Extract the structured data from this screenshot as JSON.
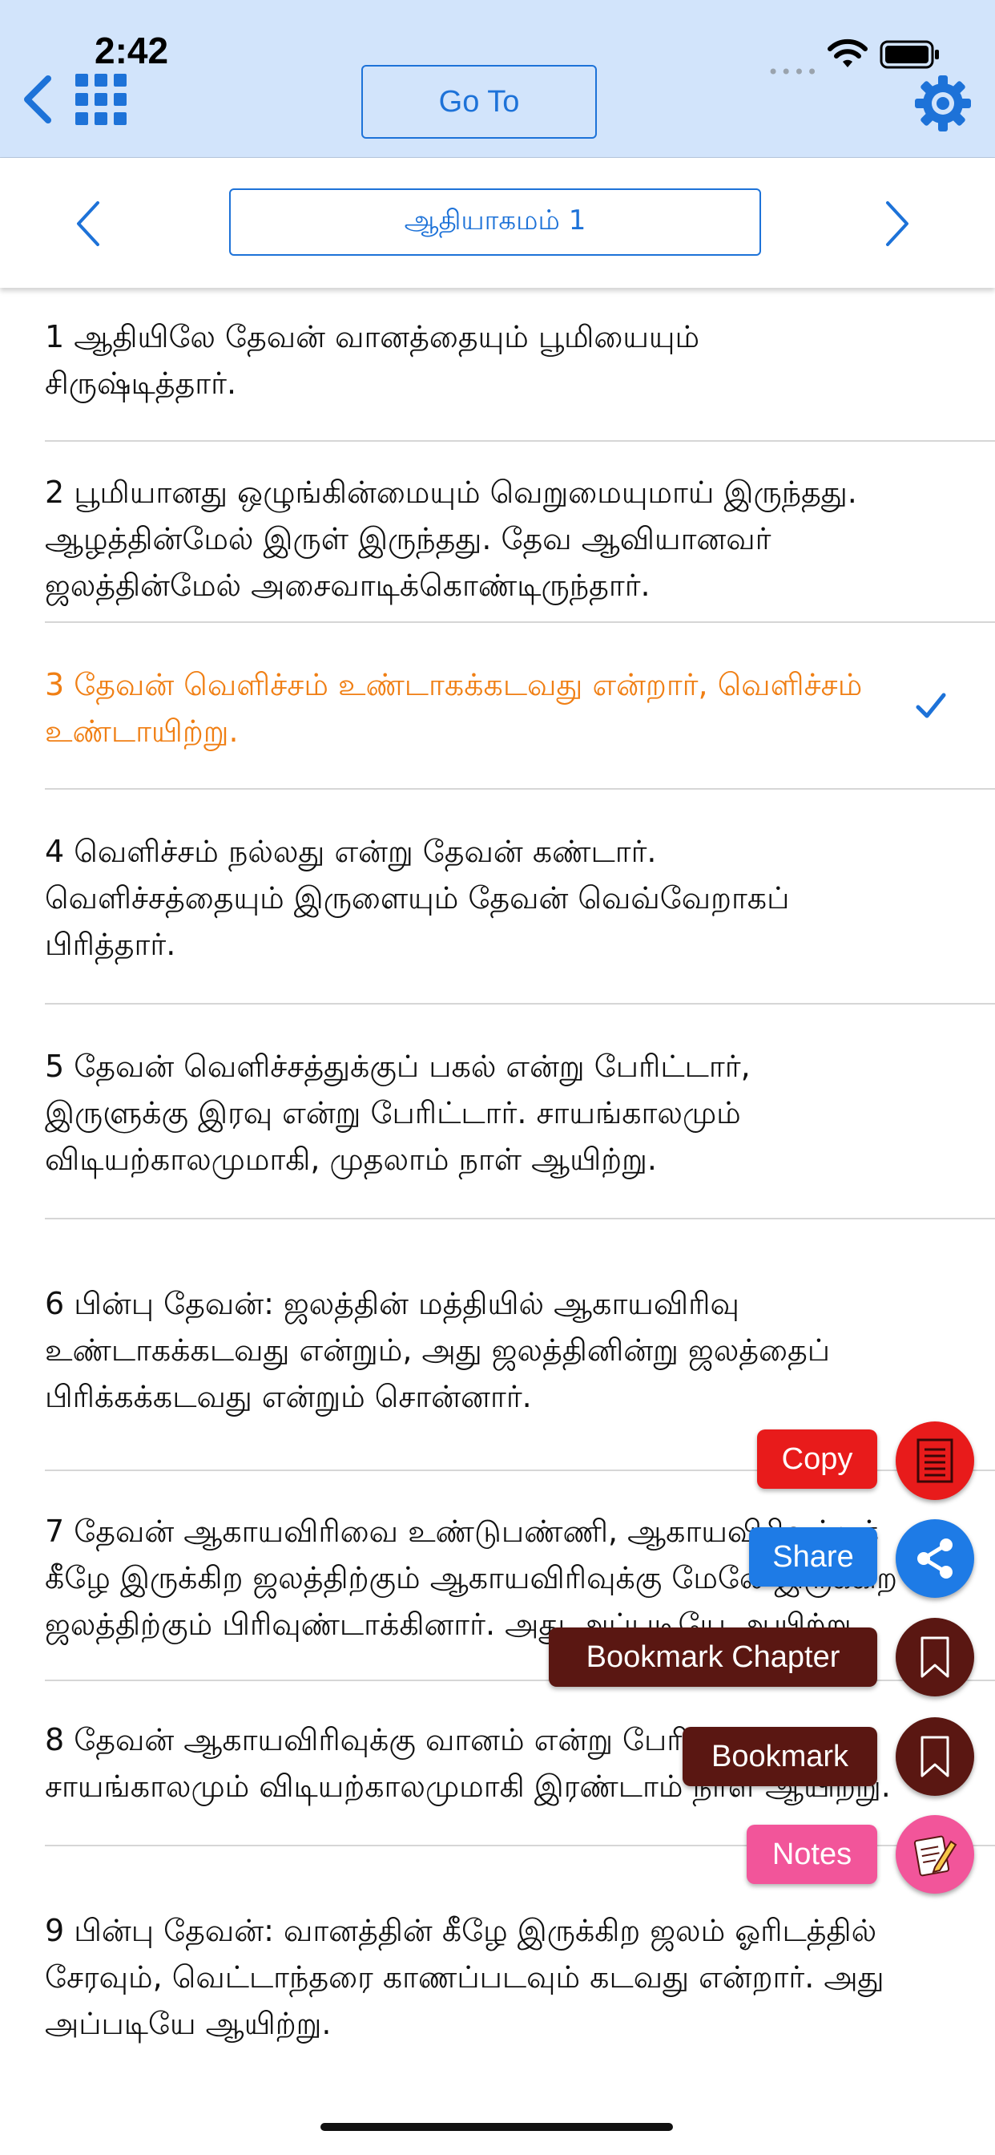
{
  "status_bar": {
    "time": "2:42",
    "signal": "••••"
  },
  "toolbar": {
    "goto_label": "Go To"
  },
  "chapter": {
    "title": "ஆதியாகமம் 1"
  },
  "verses": [
    {
      "text": "1 ஆதியிலே தேவன் வானத்தையும் பூமியையும் சிருஷ்டித்தார்."
    },
    {
      "text": "2 பூமியானது ஒழுங்கின்மையும் வெறுமையுமாய் இருந்தது. ஆழத்தின்மேல் இருள் இருந்தது. தேவ ஆவியானவர் ஜலத்தின்மேல் அசைவாடிக்கொண்டிருந்தார்."
    },
    {
      "text": "3 தேவன் வெளிச்சம் உண்டாகக்கடவது என்றார், வெளிச்சம் உண்டாயிற்று.",
      "selected": true
    },
    {
      "text": "4 வெளிச்சம் நல்லது என்று தேவன் கண்டார். வெளிச்சத்தையும் இருளையும் தேவன் வெவ்வேறாகப் பிரித்தார்."
    },
    {
      "text": "5 தேவன் வெளிச்சத்துக்குப் பகல் என்று பேரிட்டார், இருளுக்கு இரவு என்று பேரிட்டார். சாயங்காலமும் விடியற்காலமுமாகி, முதலாம் நாள் ஆயிற்று."
    },
    {
      "text": "6 பின்பு தேவன்: ஜலத்தின் மத்தியில் ஆகாயவிரிவு உண்டாகக்கடவது என்றும், அது ஜலத்தினின்று ஜலத்தைப் பிரிக்கக்கடவது என்றும் சொன்னார்."
    },
    {
      "text": "7 தேவன் ஆகாயவிரிவை உண்டுபண்ணி, ஆகாயவிரிவுக்குக் கீழே இருக்கிற ஜலத்திற்கும் ஆகாயவிரிவுக்கு மேலே இருக்கிற ஜலத்திற்கும் பிரிவுண்டாக்கினார். அது அப்படியே ஆயிற்று."
    },
    {
      "text": "8 தேவன் ஆகாயவிரிவுக்கு வானம் என்று பேரிட்டார். சாயங்காலமும் விடியற்காலமுமாகி இரண்டாம் நாள் ஆயிற்று."
    },
    {
      "text": "9 பின்பு தேவன்: வானத்தின் கீழே இருக்கிற ஜலம் ஓரிடத்தில் சேரவும், வெட்டாந்தரை காணப்படவும் கடவது என்றார். அது அப்படியே ஆயிற்று."
    }
  ],
  "actions": {
    "copy": "Copy",
    "share": "Share",
    "bookmark_chapter": "Bookmark Chapter",
    "bookmark": "Bookmark",
    "notes": "Notes"
  },
  "colors": {
    "accent": "#1d72d8",
    "selected_verse": "#f07f14",
    "copy": "#e81b1b",
    "share": "#1e7be6",
    "bookmark": "#5a1712",
    "notes": "#f2559a"
  }
}
